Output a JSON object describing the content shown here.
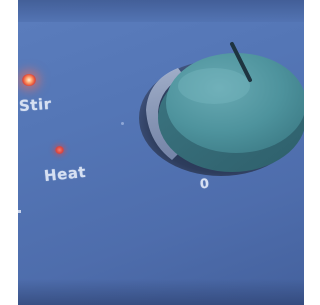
{
  "panel": {
    "labels": {
      "stir": "Stir",
      "heat": "Heat",
      "knob_zero": "0"
    },
    "indicators": {
      "stir_led_color": "#ff7a55",
      "heat_led_color": "#d8463f"
    },
    "colors": {
      "panel_blue": "#5476b6",
      "knob_teal": "#4a8f9c",
      "label_text": "#d6e0f2"
    }
  }
}
